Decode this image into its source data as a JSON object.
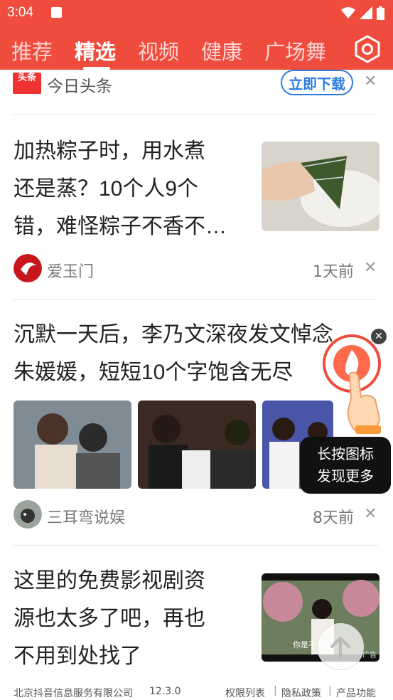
{
  "status_bar": {
    "time": "3:04"
  },
  "tabs": [
    {
      "label": "推荐",
      "active": false
    },
    {
      "label": "精选",
      "active": true
    },
    {
      "label": "视频",
      "active": false
    },
    {
      "label": "健康",
      "active": false
    },
    {
      "label": "广场舞",
      "active": false
    }
  ],
  "ad": {
    "logo_text": "头条",
    "title": "今日头条",
    "button": "立即下载"
  },
  "articles": [
    {
      "title_lines": [
        "加热粽子时，用水煮",
        "还是蒸？10个人9个",
        "错，难怪粽子不香不…"
      ],
      "source": "爱玉门",
      "time": "1天前"
    },
    {
      "title_lines": [
        "沉默一天后，李乃文深夜发文悼念",
        "朱媛媛，短短10个字饱含无尽"
      ],
      "source": "三耳弯说娱",
      "time": "8天前"
    },
    {
      "title_lines": [
        "这里的免费影视剧资",
        "源也太多了吧，再也",
        "不用到处找了"
      ],
      "thumb_caption": "你是不是下...",
      "thumb_tag": "广告"
    }
  ],
  "tooltip": {
    "line1": "长按图标",
    "line2": "发现更多"
  },
  "footer": {
    "company": "北京抖音信息服务有限公司",
    "version": "12.3.0",
    "links": [
      "权限列表",
      "隐私政策",
      "产品功能"
    ]
  },
  "colors": {
    "brand_red": "#f04c3e",
    "link_blue": "#2d7be0"
  }
}
